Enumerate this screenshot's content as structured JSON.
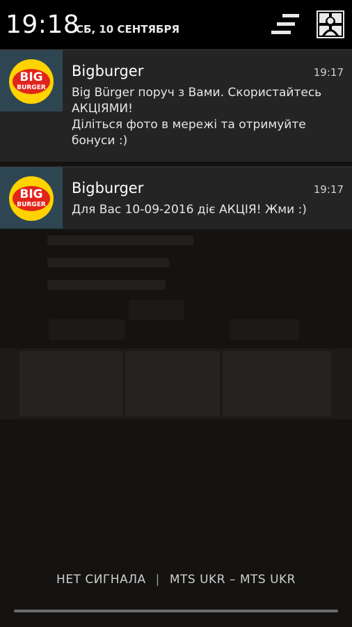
{
  "status": {
    "time": "19:18",
    "date": "СБ, 10 СЕНТЯБРЯ",
    "icons": [
      "settings-toggle-icon",
      "user-profile-icon"
    ]
  },
  "notifications": [
    {
      "app_icon": "bigburger-logo",
      "logo_line1": "BIG",
      "logo_line2": "BURGER",
      "title": "Bigburger",
      "time": "19:17",
      "text": "Big Bürger поруч з Вами. Скористайтесь АКЦІЯМИ!\nДіліться фото в мережі та отримуйте бонуси :)"
    },
    {
      "app_icon": "bigburger-logo",
      "logo_line1": "BIG",
      "logo_line2": "BURGER",
      "title": "Bigburger",
      "time": "19:17",
      "text": "Для Вас 10-09-2016 діє АКЦІЯ! Жми :)"
    }
  ],
  "footer": {
    "no_signal": "НЕТ СИГНАЛА",
    "separator": "|",
    "operator": "MTS UKR – MTS UKR"
  },
  "colors": {
    "header_bg": "#000000",
    "notification_bg": "#242424",
    "icon_box_bg": "#2d4652",
    "logo_red": "#e1251b",
    "logo_yellow": "#ffd200"
  }
}
